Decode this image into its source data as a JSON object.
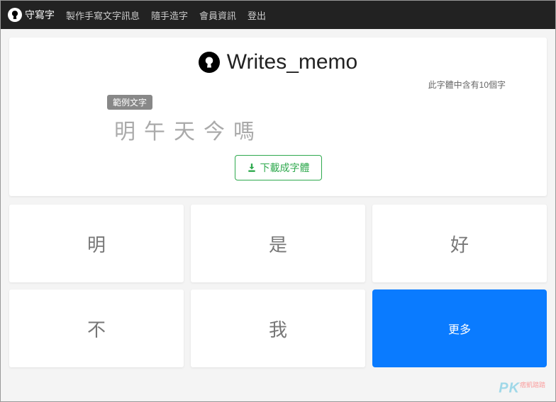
{
  "nav": {
    "brand": "守寫字",
    "links": [
      "製作手寫文字訊息",
      "隨手造字",
      "會員資訊",
      "登出"
    ]
  },
  "main": {
    "title": "Writes_memo",
    "count_note": "此字體中含有10個字",
    "sample_badge": "範例文字",
    "sample_text": "明午天今嗎",
    "download_label": "下載成字體"
  },
  "grid": {
    "chars": [
      "明",
      "是",
      "好",
      "不",
      "我"
    ],
    "more_label": "更多"
  },
  "watermark": {
    "main": "PK",
    "sub": "痞凱踏踏"
  }
}
